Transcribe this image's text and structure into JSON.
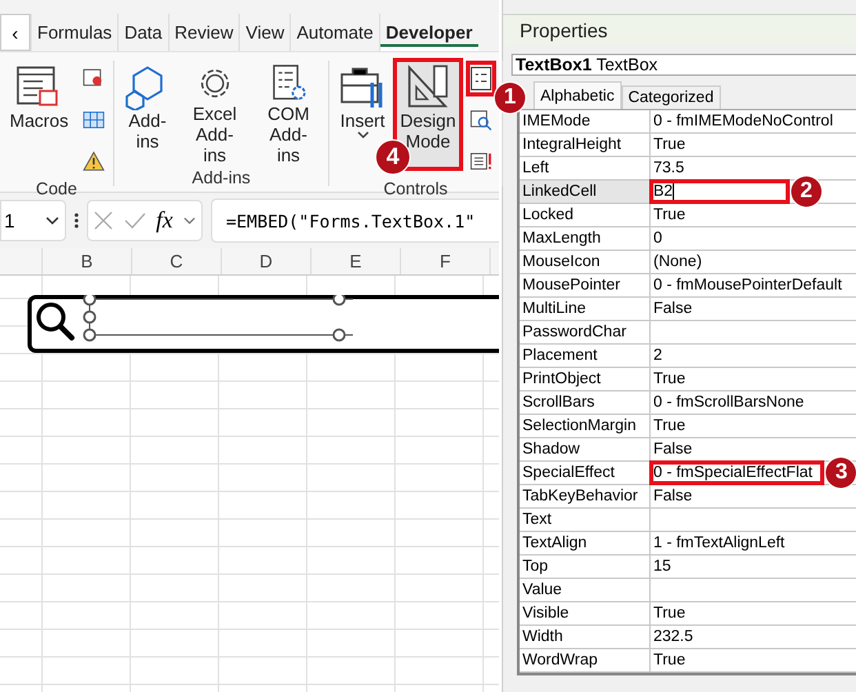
{
  "ribbon_tabs": [
    {
      "label": "Formulas",
      "selected": false
    },
    {
      "label": "Data",
      "selected": false
    },
    {
      "label": "Review",
      "selected": false
    },
    {
      "label": "View",
      "selected": false
    },
    {
      "label": "Automate",
      "selected": false
    },
    {
      "label": "Developer",
      "selected": true
    }
  ],
  "scroll_left": "‹",
  "ribbon_groups": [
    {
      "label": "Code",
      "buttons": [
        {
          "label": "Macros",
          "pressed": false,
          "highlighted": false
        }
      ]
    },
    {
      "label": "Add-ins",
      "buttons": [
        {
          "label": "Add-ins",
          "pressed": false,
          "highlighted": false
        },
        {
          "label": "Excel Add-ins",
          "pressed": false,
          "highlighted": false
        },
        {
          "label": "COM Add-ins",
          "pressed": false,
          "highlighted": false
        }
      ]
    },
    {
      "label": "Controls",
      "buttons": [
        {
          "label": "Insert",
          "pressed": false,
          "highlighted": false
        },
        {
          "label": "Design Mode",
          "pressed": true,
          "highlighted": true,
          "callout": "4"
        }
      ],
      "small_buttons": [
        {
          "highlighted": true,
          "callout": "1"
        },
        {
          "highlighted": false
        },
        {
          "highlighted": false
        }
      ]
    }
  ],
  "formula_bar": {
    "name_box": "1",
    "fx": "fx",
    "formula": "=EMBED(\"Forms.TextBox.1\""
  },
  "column_headers": [
    "B",
    "C",
    "D",
    "E",
    "F"
  ],
  "embedded_textbox": {
    "selected": true
  },
  "properties": {
    "title": "Properties",
    "object": "**TextBox1** TextBox",
    "tabs": [
      {
        "label": "Alphabetic",
        "selected": true
      },
      {
        "label": "Categorized",
        "selected": false
      }
    ],
    "rows": [
      {
        "name": "IMEMode",
        "value": "0 - fmIMEModeNoControl",
        "selected": false,
        "highlighted": false
      },
      {
        "name": "IntegralHeight",
        "value": "True",
        "selected": false,
        "highlighted": false
      },
      {
        "name": "Left",
        "value": "73.5",
        "selected": false,
        "highlighted": false
      },
      {
        "name": "LinkedCell",
        "value": "B2",
        "selected": true,
        "highlighted": true,
        "callout": "2"
      },
      {
        "name": "Locked",
        "value": "True",
        "selected": false,
        "highlighted": false
      },
      {
        "name": "MaxLength",
        "value": "0",
        "selected": false,
        "highlighted": false
      },
      {
        "name": "MouseIcon",
        "value": "(None)",
        "selected": false,
        "highlighted": false
      },
      {
        "name": "MousePointer",
        "value": "0 - fmMousePointerDefault",
        "selected": false,
        "highlighted": false
      },
      {
        "name": "MultiLine",
        "value": "False",
        "selected": false,
        "highlighted": false
      },
      {
        "name": "PasswordChar",
        "selected": false,
        "highlighted": false
      },
      {
        "name": "Placement",
        "value": "2",
        "selected": false,
        "highlighted": false
      },
      {
        "name": "PrintObject",
        "value": "True",
        "selected": false,
        "highlighted": false
      },
      {
        "name": "ScrollBars",
        "value": "0 - fmScrollBarsNone",
        "selected": false,
        "highlighted": false
      },
      {
        "name": "SelectionMargin",
        "value": "True",
        "selected": false,
        "highlighted": false
      },
      {
        "name": "Shadow",
        "value": "False",
        "selected": false,
        "highlighted": false
      },
      {
        "name": "SpecialEffect",
        "value": "0 - fmSpecialEffectFlat",
        "selected": false,
        "highlighted": true,
        "callout": "3"
      },
      {
        "name": "TabKeyBehavior",
        "value": "False",
        "selected": false,
        "highlighted": false
      },
      {
        "name": "Text",
        "selected": false,
        "highlighted": false
      },
      {
        "name": "TextAlign",
        "value": "1 - fmTextAlignLeft",
        "selected": false,
        "highlighted": false
      },
      {
        "name": "Top",
        "value": "15",
        "selected": false,
        "highlighted": false
      },
      {
        "name": "Value",
        "selected": false,
        "highlighted": false
      },
      {
        "name": "Visible",
        "value": "True",
        "selected": false,
        "highlighted": false
      },
      {
        "name": "Width",
        "value": "232.5",
        "selected": false,
        "highlighted": false
      },
      {
        "name": "WordWrap",
        "value": "True",
        "selected": false,
        "highlighted": false
      }
    ]
  }
}
